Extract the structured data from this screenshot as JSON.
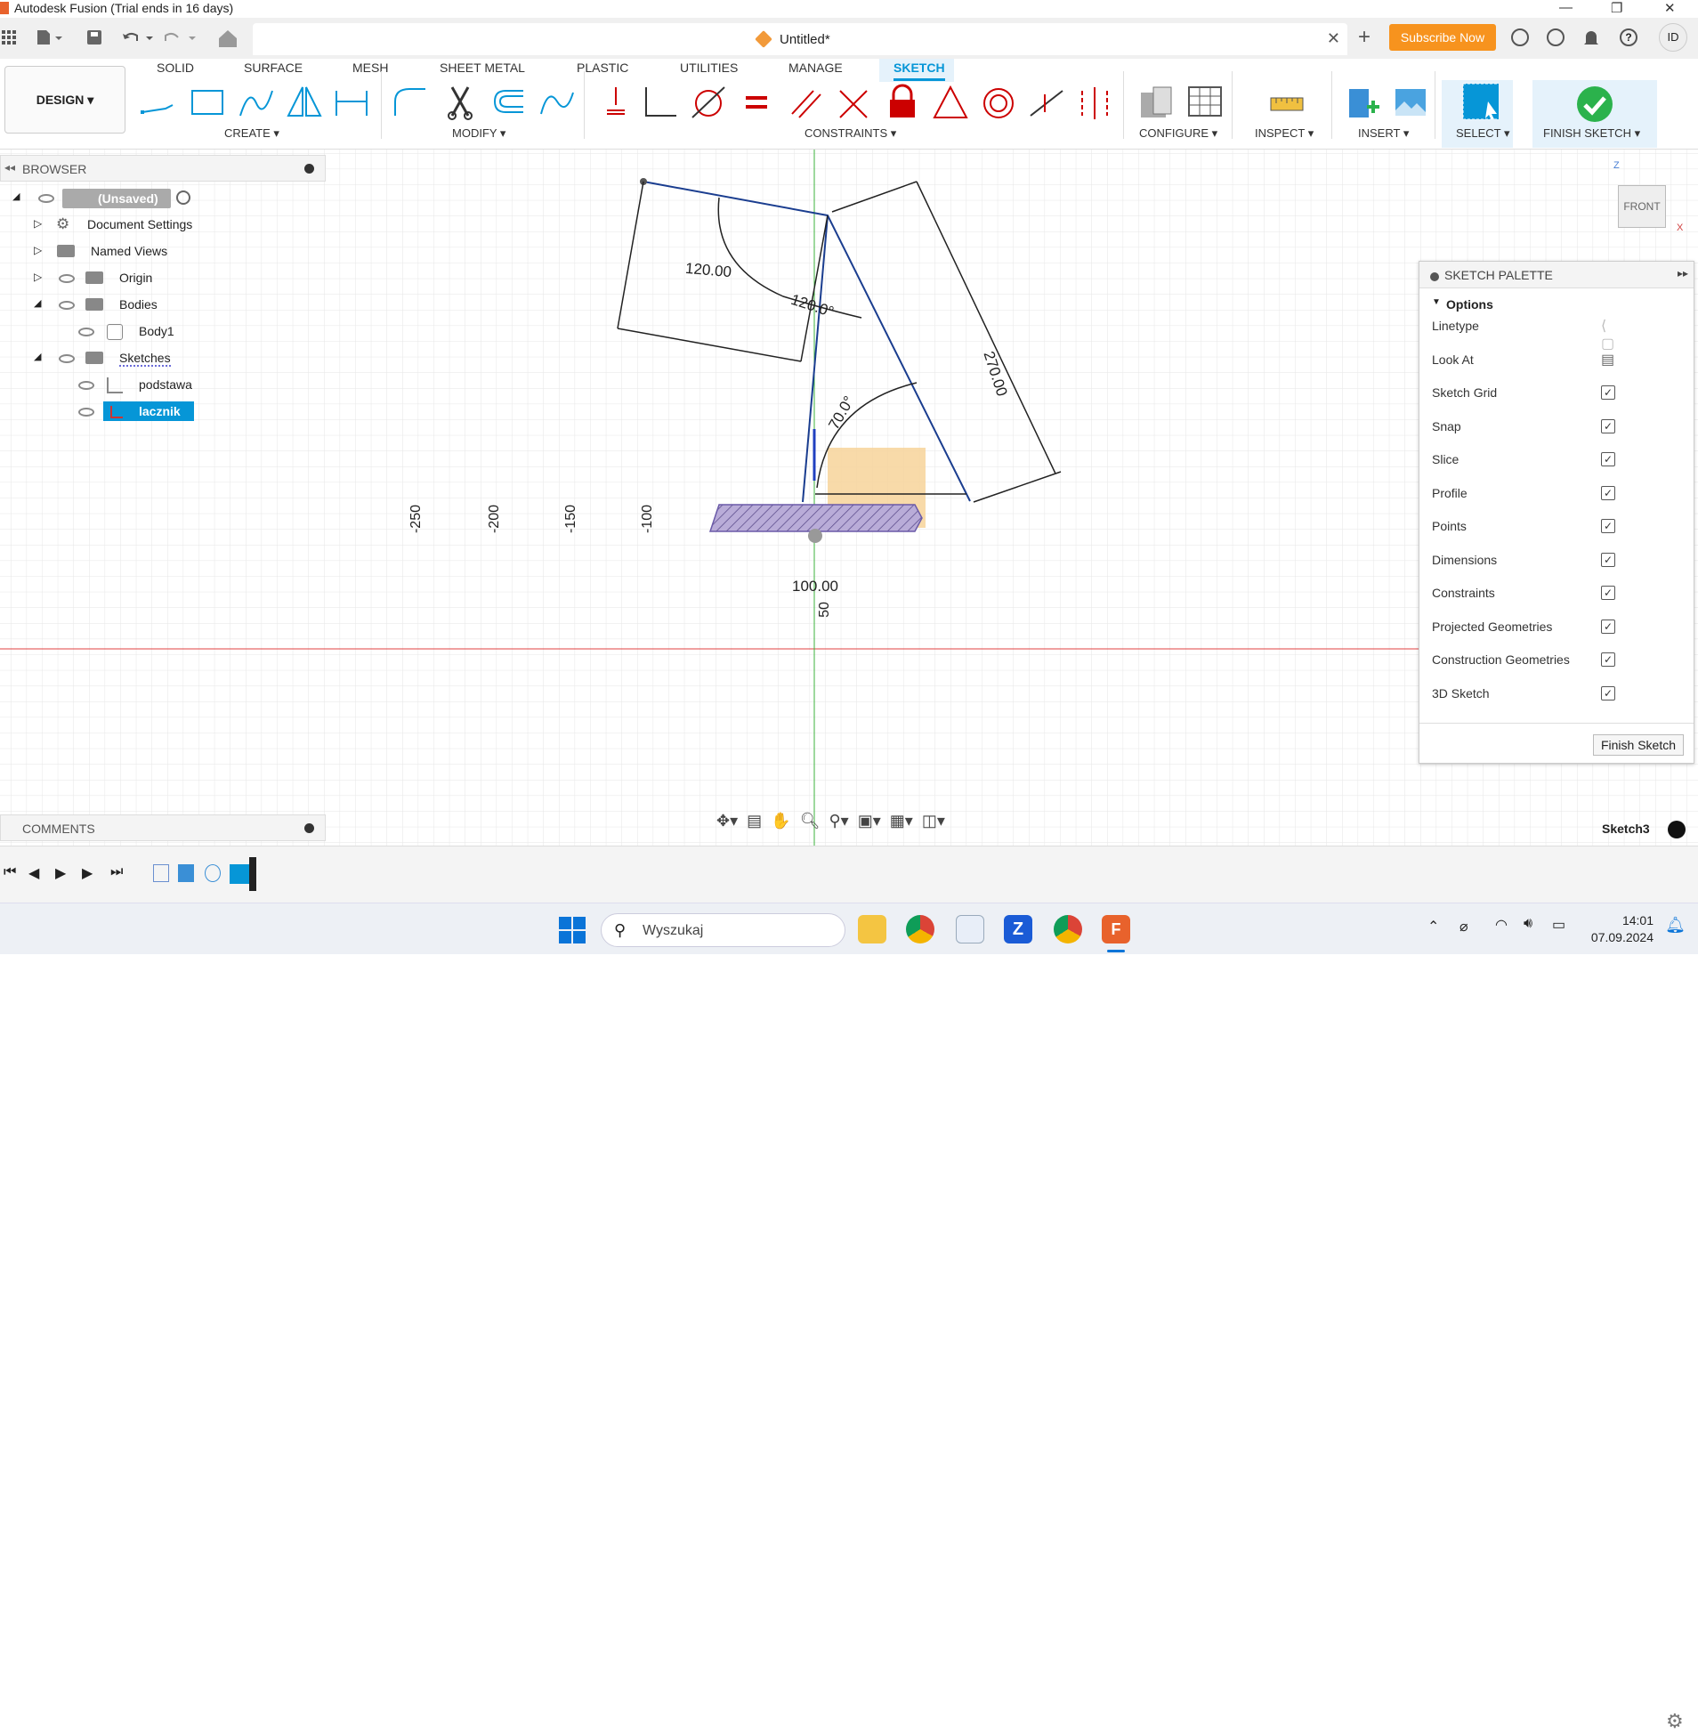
{
  "window": {
    "title": "Autodesk Fusion (Trial ends in 16 days)",
    "min": "—",
    "max": "❐",
    "close": "✕"
  },
  "doc_tab": {
    "name": "Untitled*",
    "close": "✕"
  },
  "header": {
    "subscribe": "Subscribe Now",
    "user": "ID",
    "add": "+"
  },
  "toolbar": {
    "workspace": "DESIGN ▾",
    "tabs": [
      "SOLID",
      "SURFACE",
      "MESH",
      "SHEET METAL",
      "PLASTIC",
      "UTILITIES",
      "MANAGE",
      "SKETCH"
    ],
    "active_tab": "SKETCH",
    "groups": {
      "create": "CREATE ▾",
      "modify": "MODIFY ▾",
      "constraints": "CONSTRAINTS ▾",
      "configure": "CONFIGURE ▾",
      "inspect": "INSPECT ▾",
      "insert": "INSERT ▾",
      "select": "SELECT ▾",
      "finish": "FINISH SKETCH ▾"
    }
  },
  "browser": {
    "title": "BROWSER",
    "items": {
      "root": "(Unsaved)",
      "doc_settings": "Document Settings",
      "named_views": "Named Views",
      "origin": "Origin",
      "bodies": "Bodies",
      "body1": "Body1",
      "sketches": "Sketches",
      "podstawa": "podstawa",
      "lacznik": "lacznik"
    }
  },
  "comments": {
    "title": "COMMENTS"
  },
  "viewcube": {
    "face": "FRONT",
    "z": "Z",
    "x": "X"
  },
  "sketch": {
    "dims": {
      "a": "120.00",
      "b": "120.0°",
      "c": "270.00",
      "d": "70.0°",
      "e": "100.00"
    },
    "ruler": {
      "m250": "-250",
      "m200": "-200",
      "m150": "-150",
      "m100": "-100",
      "p50": "50"
    }
  },
  "palette": {
    "title": "SKETCH PALETTE",
    "section": "Options",
    "rows": {
      "linetype": "Linetype",
      "look_at": "Look At",
      "grid": "Sketch Grid",
      "snap": "Snap",
      "slice": "Slice",
      "profile": "Profile",
      "points": "Points",
      "dimensions": "Dimensions",
      "constraints": "Constraints",
      "projected": "Projected Geometries",
      "construction": "Construction Geometries",
      "sketch3d": "3D Sketch"
    },
    "finish": "Finish Sketch"
  },
  "status": {
    "sketch_name": "Sketch3"
  },
  "taskbar": {
    "search": "Wyszukaj",
    "time": "14:01",
    "date": "07.09.2024"
  },
  "colors": {
    "accent": "#0696d7",
    "subscribe": "#f7931e",
    "finish": "#2bb24c"
  }
}
